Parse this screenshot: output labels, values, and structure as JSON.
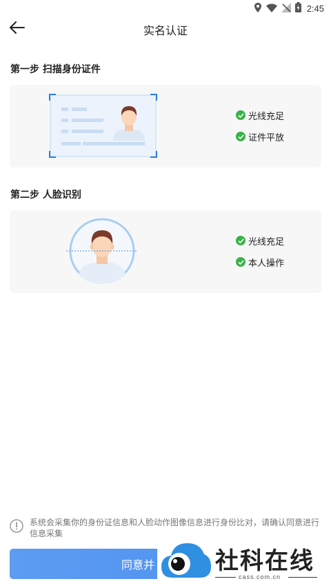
{
  "status_bar": {
    "time": "2:45"
  },
  "header": {
    "title": "实名认证"
  },
  "step1": {
    "title": "第一步 扫描身份证件",
    "checks": [
      "光线充足",
      "证件平放"
    ]
  },
  "step2": {
    "title": "第二步 人脸识别",
    "checks": [
      "光线充足",
      "本人操作"
    ]
  },
  "notice": {
    "text": "系统会采集你的身份证信息和人脸动作图像信息进行身份比对，请确认同意进行信息采集"
  },
  "agree_button": {
    "label": "同意并"
  },
  "watermark": {
    "text": "社科在线",
    "url": "cass.com.cn"
  },
  "colors": {
    "accent": "#4b8ef0",
    "check": "#3bb249",
    "card_bg": "#f7f7f7"
  },
  "icons": [
    "location-icon",
    "wifi-icon",
    "no-signal-icon",
    "battery-icon",
    "back-arrow-icon",
    "check-icon",
    "info-icon",
    "cloud-eye-logo-icon"
  ]
}
